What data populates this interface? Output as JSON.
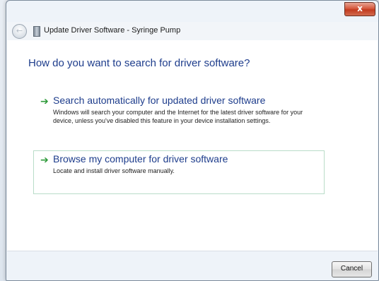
{
  "window": {
    "title": "Update Driver Software - Syringe Pump",
    "close_glyph": "x"
  },
  "icons": {
    "back": "back-arrow-icon",
    "device": "device-icon",
    "close": "close-icon",
    "option_arrow": "green-arrow-icon"
  },
  "colors": {
    "heading": "#1e3d8c",
    "arrow": "#2e9a3a",
    "close_button": "#c94a30"
  },
  "heading": "How do you want to search for driver software?",
  "options": [
    {
      "title": "Search automatically for updated driver software",
      "description": "Windows will search your computer and the Internet for the latest driver software for your device, unless you've disabled this feature in your device installation settings."
    },
    {
      "title": "Browse my computer for driver software",
      "description": "Locate and install driver software manually."
    }
  ],
  "footer": {
    "cancel_label": "Cancel"
  }
}
